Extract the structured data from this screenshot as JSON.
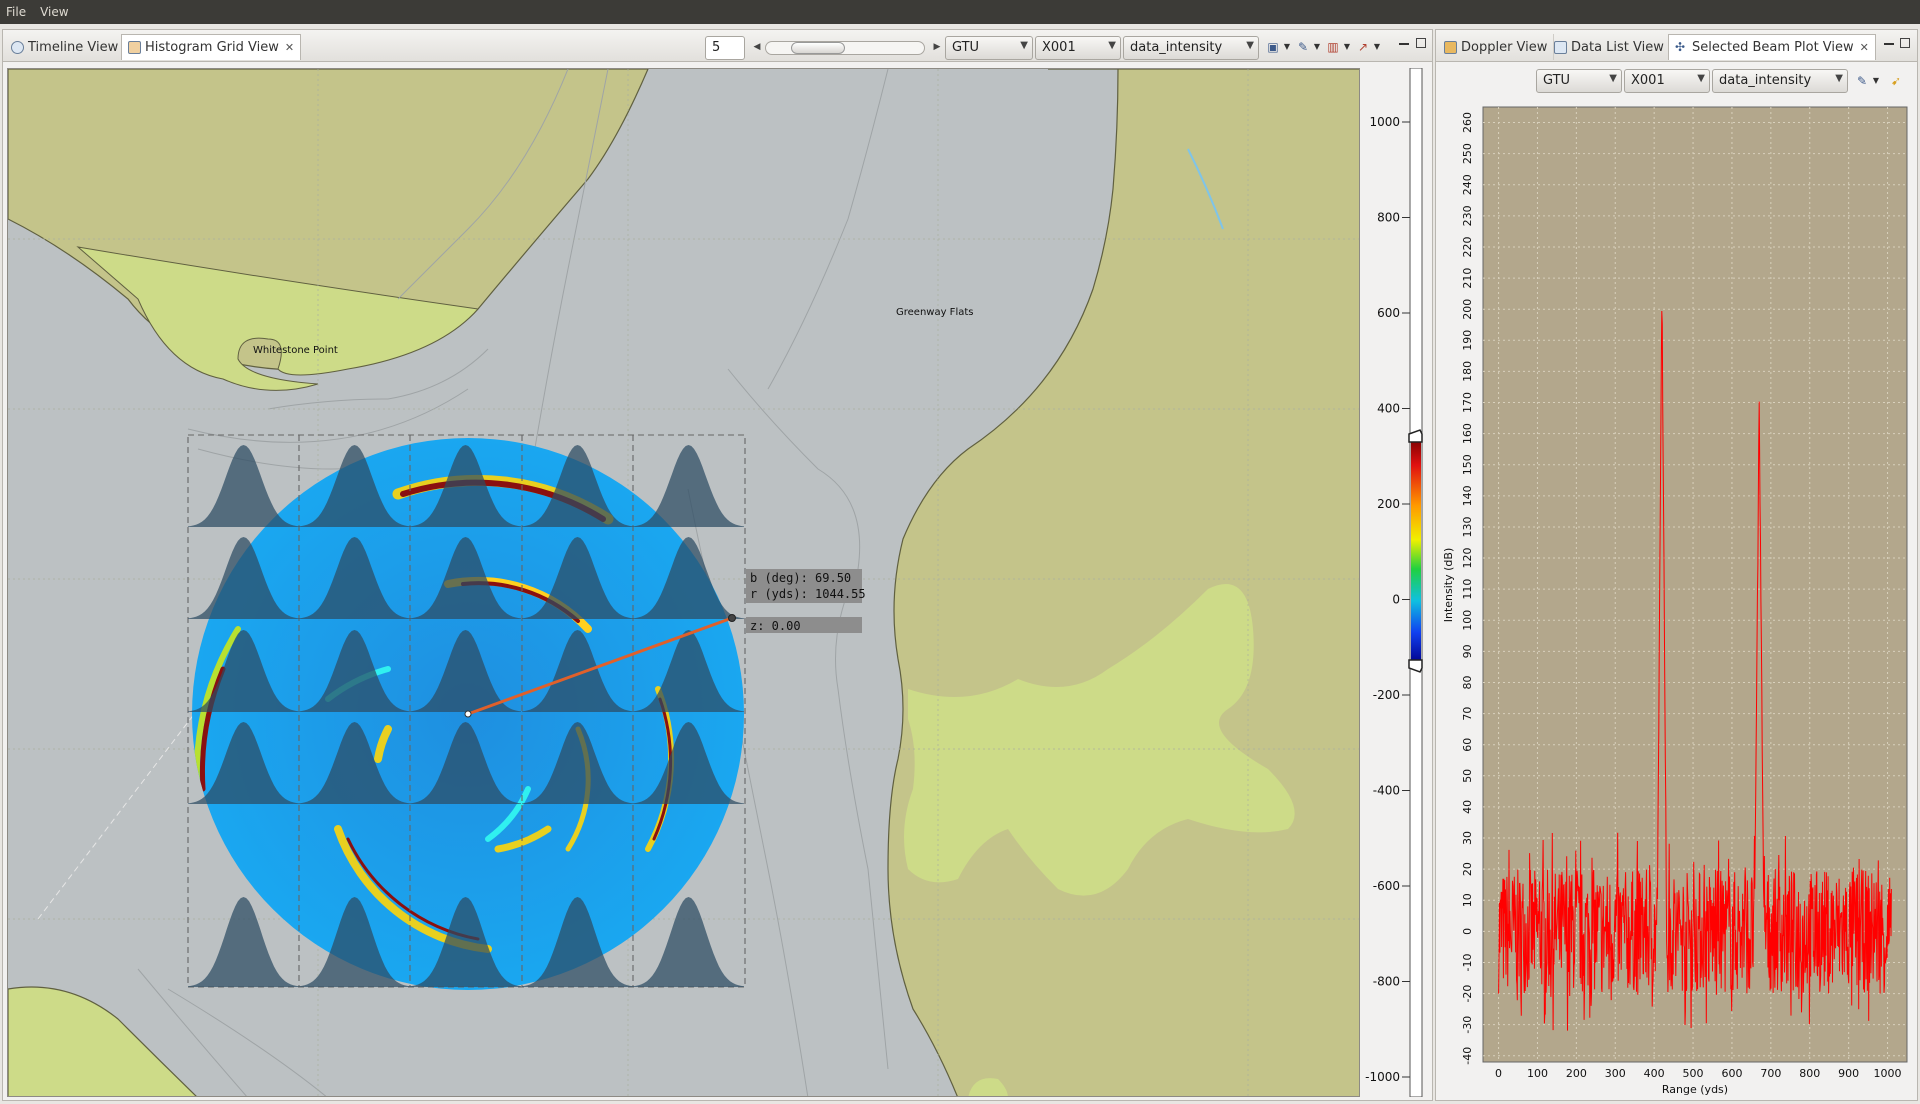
{
  "menu": {
    "file": "File",
    "view": "View"
  },
  "left_pane": {
    "tabs": [
      {
        "label": "Timeline View",
        "active": false
      },
      {
        "label": "Histogram Grid View",
        "active": true
      }
    ],
    "toolbar": {
      "grid_size_value": "5",
      "source_combo": "GTU",
      "channel_combo": "X001",
      "field_combo": "data_intensity"
    }
  },
  "map": {
    "labels": {
      "whitestone": "Whitestone Point",
      "greenway": "Greenway Flats"
    },
    "readout": {
      "bearing": "b (deg): 69.50",
      "range": "r (yds): 1044.55",
      "z": "z: 0.00"
    },
    "colors": {
      "land": "#c4c48a",
      "shoal": "#cddb88",
      "water": "#bcc1c3",
      "sonar": "#1e9be8"
    }
  },
  "color_scale": {
    "ticks": [
      "1000",
      "800",
      "600",
      "400",
      "200",
      "0",
      "-200",
      "-400",
      "-600",
      "-800",
      "-1000"
    ]
  },
  "right_pane": {
    "tabs": [
      {
        "label": "Doppler View",
        "active": false
      },
      {
        "label": "Data List View",
        "active": false
      },
      {
        "label": "Selected Beam Plot View",
        "active": true
      }
    ],
    "toolbar": {
      "source_combo": "GTU",
      "channel_combo": "X001",
      "field_combo": "data_intensity"
    }
  },
  "chart_data": {
    "type": "line",
    "xlabel": "Range (yds)",
    "ylabel": "Intensity (dB)",
    "xlim": [
      -40,
      1050
    ],
    "ylim": [
      -42,
      265
    ],
    "x_ticks": [
      "0",
      "100",
      "200",
      "300",
      "400",
      "500",
      "600",
      "700",
      "800",
      "900",
      "1000"
    ],
    "y_ticks": [
      "260",
      "250",
      "240",
      "230",
      "220",
      "210",
      "200",
      "190",
      "180",
      "170",
      "160",
      "150",
      "140",
      "130",
      "120",
      "110",
      "100",
      "90",
      "80",
      "70",
      "60",
      "50",
      "40",
      "30",
      "20",
      "10",
      "0",
      "-10",
      "-20",
      "-30",
      "-40"
    ],
    "grid": true,
    "series": [
      {
        "color": "#ff0000",
        "noise_band": [
          -20,
          20
        ],
        "noise_x_range": [
          0,
          1010
        ],
        "peaks": [
          {
            "x": 420,
            "y": 208
          },
          {
            "x": 670,
            "y": 170
          }
        ]
      }
    ]
  }
}
